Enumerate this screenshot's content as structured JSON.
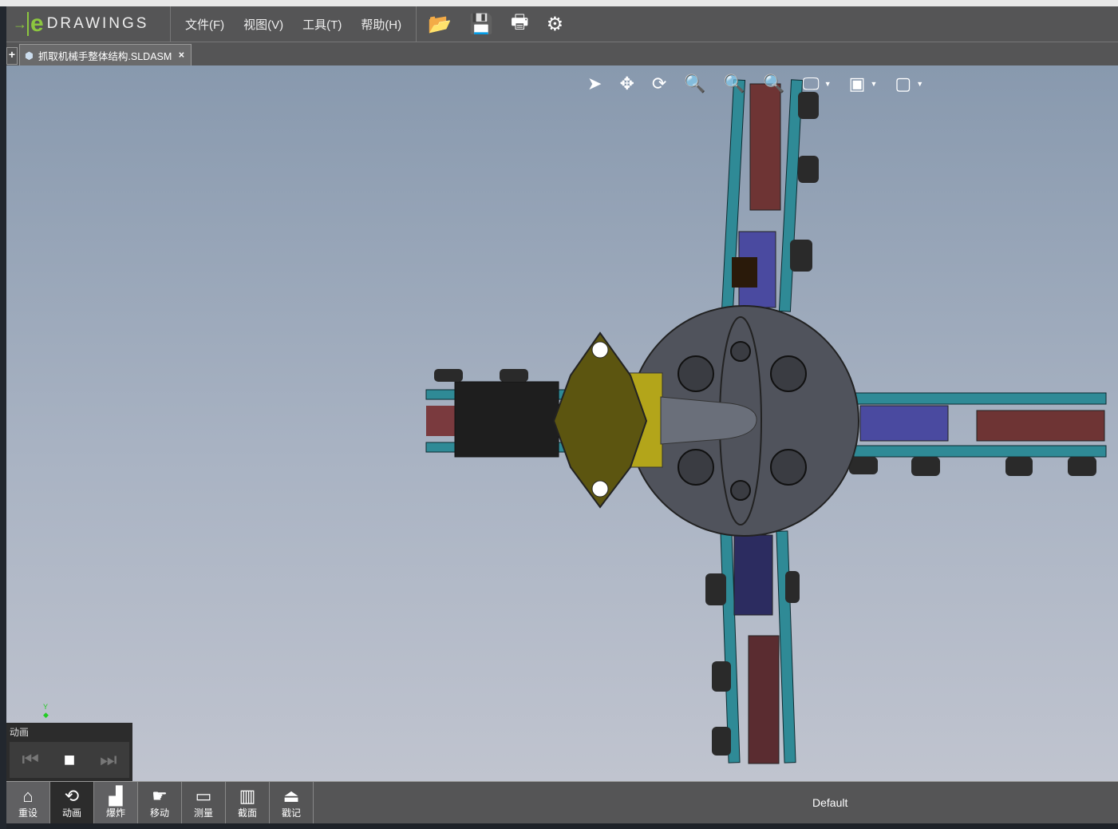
{
  "app": {
    "logo_e": "e",
    "logo_text": "DRAWINGS",
    "logo_reg": "®"
  },
  "menu": [
    {
      "label": "文件(F)"
    },
    {
      "label": "视图(V)"
    },
    {
      "label": "工具(T)"
    },
    {
      "label": "帮助(H)"
    }
  ],
  "toolbar_icons": [
    "open-icon",
    "save-icon",
    "print-icon",
    "settings-icon"
  ],
  "tab": {
    "title": "抓取机械手整体结构.SLDASM",
    "close": "×",
    "new": "+"
  },
  "view_tools": [
    "select-icon",
    "pan-icon",
    "rotate-icon",
    "zoom-icon",
    "zoom-to-area-icon",
    "zoom-to-fit-icon",
    "display-style-icon",
    "view-orientation-icon",
    "views-icon"
  ],
  "axis": {
    "y": "Y"
  },
  "animation": {
    "title": "动画"
  },
  "bottom_tools": [
    {
      "label": "重设",
      "icon": "home-icon"
    },
    {
      "label": "动画",
      "icon": "animate-icon"
    },
    {
      "label": "爆炸",
      "icon": "explode-icon"
    },
    {
      "label": "移动",
      "icon": "move-icon"
    },
    {
      "label": "测量",
      "icon": "measure-icon"
    },
    {
      "label": "截面",
      "icon": "section-icon"
    },
    {
      "label": "戳记",
      "icon": "stamp-icon"
    }
  ],
  "configuration": "Default",
  "colors": {
    "toolbar": "#555556",
    "accent": "#8cc63f",
    "teal": "#2f8a96",
    "red": "#7a3a3e",
    "purple": "#4a4aa0",
    "hub": "#50535c",
    "olive": "#5c5510"
  }
}
